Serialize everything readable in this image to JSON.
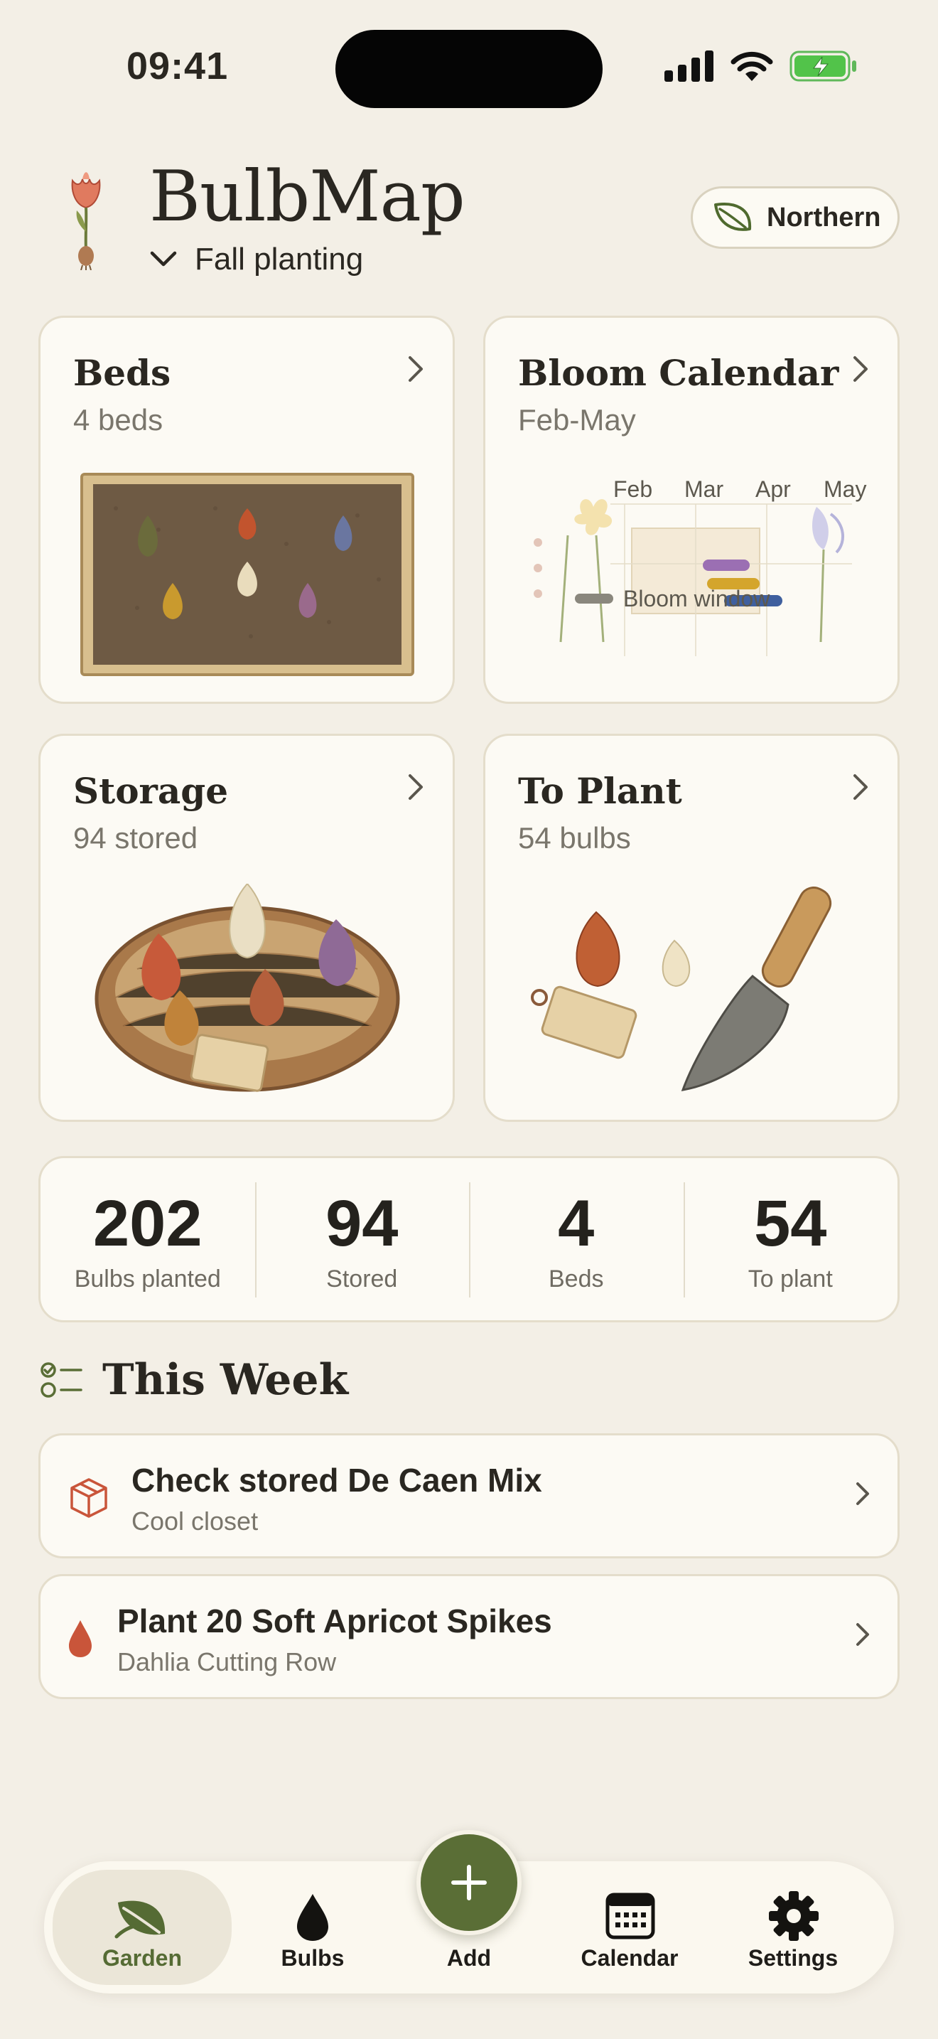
{
  "status_bar": {
    "time": "09:41"
  },
  "header": {
    "app_title": "BulbMap",
    "season": "Fall planting",
    "hemisphere": "Northern"
  },
  "cards": {
    "beds": {
      "title": "Beds",
      "subtitle": "4 beds"
    },
    "bloom_calendar": {
      "title": "Bloom Calendar",
      "subtitle": "Feb-May",
      "months": [
        "Feb",
        "Mar",
        "Apr",
        "May"
      ],
      "legend_label": "Bloom window",
      "bar_colors": [
        "#9b6fb3",
        "#d4a52c",
        "#3f5f9e"
      ]
    },
    "storage": {
      "title": "Storage",
      "subtitle": "94 stored"
    },
    "to_plant": {
      "title": "To Plant",
      "subtitle": "54 bulbs"
    }
  },
  "stats": [
    {
      "value": "202",
      "label": "Bulbs planted"
    },
    {
      "value": "94",
      "label": "Stored"
    },
    {
      "value": "4",
      "label": "Beds"
    },
    {
      "value": "54",
      "label": "To plant"
    }
  ],
  "this_week": {
    "title": "This Week",
    "tasks": [
      {
        "title": "Check stored De Caen Mix",
        "subtitle": "Cool closet",
        "icon": "box-icon"
      },
      {
        "title": "Plant 20 Soft Apricot Spikes",
        "subtitle": "Dahlia Cutting Row",
        "icon": "drop-icon"
      }
    ]
  },
  "tabbar": {
    "items": [
      {
        "label": "Garden",
        "icon": "leaf-icon",
        "active": true
      },
      {
        "label": "Bulbs",
        "icon": "bulb-drop-icon",
        "active": false
      },
      {
        "label": "Add",
        "icon": "plus-icon",
        "active": false
      },
      {
        "label": "Calendar",
        "icon": "calendar-icon",
        "active": false
      },
      {
        "label": "Settings",
        "icon": "gear-icon",
        "active": false
      }
    ]
  },
  "colors": {
    "background": "#f3efe6",
    "card": "#fcfaf4",
    "accent_green": "#5a6e36",
    "task_red": "#c9553a"
  }
}
